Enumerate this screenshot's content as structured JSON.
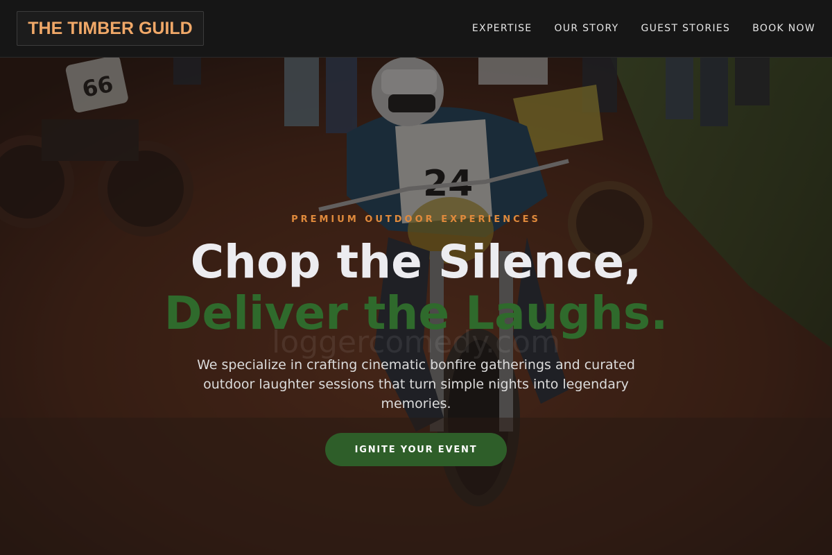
{
  "brand": {
    "name": "THE TIMBER GUILD",
    "color": "#f0a868"
  },
  "nav": {
    "items": [
      {
        "label": "EXPERTISE"
      },
      {
        "label": "OUR STORY"
      },
      {
        "label": "GUEST STORIES"
      },
      {
        "label": "BOOK NOW"
      }
    ]
  },
  "hero": {
    "kicker": "PREMIUM OUTDOOR EXPERIENCES",
    "headline_line1": "Chop the Silence,",
    "headline_line2": "Deliver the Laughs.",
    "watermark": "loggercomedy.com",
    "subtitle": "We specialize in crafting cinematic bonfire gatherings and curated outdoor laughter sessions that turn simple nights into legendary memories.",
    "cta_label": "IGNITE YOUR EVENT",
    "background_image": "motorcycle-race-dirt-track-photo"
  },
  "colors": {
    "accent_orange": "#e08a3c",
    "accent_green": "#2f6a2c",
    "button_green": "#2e5e29",
    "nav_bg": "#161616"
  }
}
